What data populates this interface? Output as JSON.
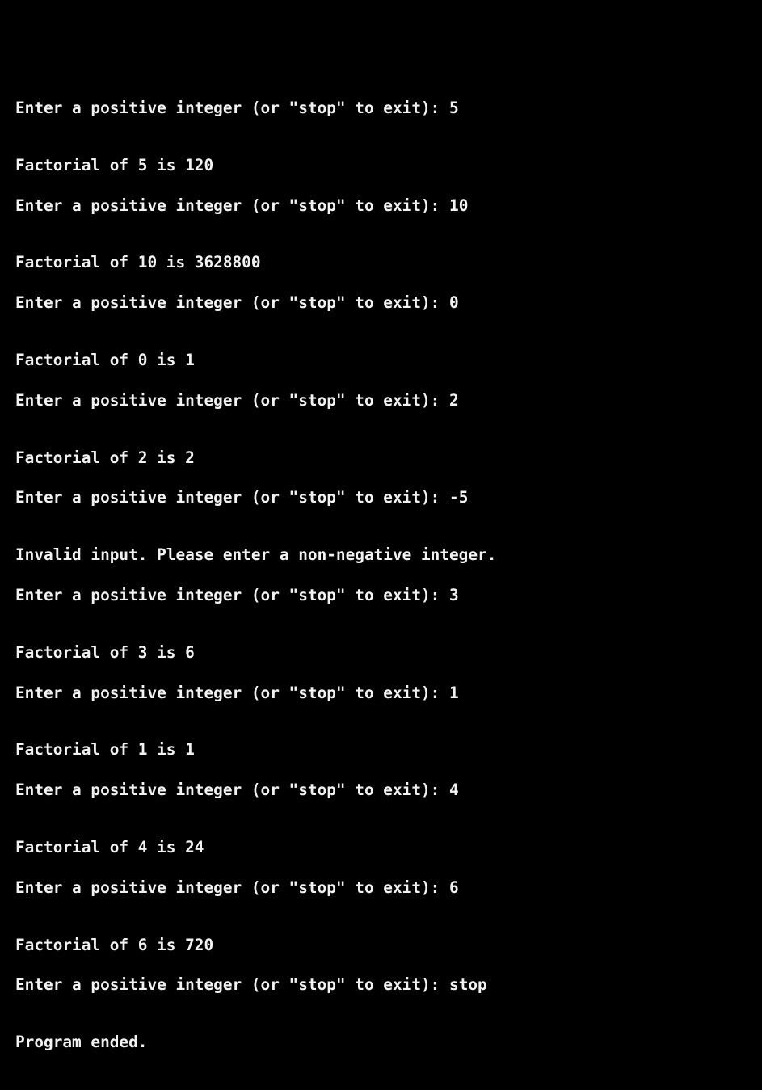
{
  "terminal": {
    "background": "#000000",
    "foreground": "#f2f2f2",
    "sessions": [
      {
        "prompt": "Enter a positive integer (or \"stop\" to exit): ",
        "input": "5",
        "output": "Factorial of 5 is 120"
      },
      {
        "prompt": "Enter a positive integer (or \"stop\" to exit): ",
        "input": "10",
        "output": "Factorial of 10 is 3628800"
      },
      {
        "prompt": "Enter a positive integer (or \"stop\" to exit): ",
        "input": "0",
        "output": "Factorial of 0 is 1"
      },
      {
        "prompt": "Enter a positive integer (or \"stop\" to exit): ",
        "input": "2",
        "output": "Factorial of 2 is 2"
      },
      {
        "prompt": "Enter a positive integer (or \"stop\" to exit): ",
        "input": "-5",
        "output": "Invalid input. Please enter a non-negative integer."
      },
      {
        "prompt": "Enter a positive integer (or \"stop\" to exit): ",
        "input": "3",
        "output": "Factorial of 3 is 6"
      },
      {
        "prompt": "Enter a positive integer (or \"stop\" to exit): ",
        "input": "1",
        "output": "Factorial of 1 is 1"
      },
      {
        "prompt": "Enter a positive integer (or \"stop\" to exit): ",
        "input": "4",
        "output": "Factorial of 4 is 24"
      },
      {
        "prompt": "Enter a positive integer (or \"stop\" to exit): ",
        "input": "6",
        "output": "Factorial of 6 is 720"
      },
      {
        "prompt": "Enter a positive integer (or \"stop\" to exit): ",
        "input": "stop",
        "output": "Program ended."
      }
    ]
  }
}
